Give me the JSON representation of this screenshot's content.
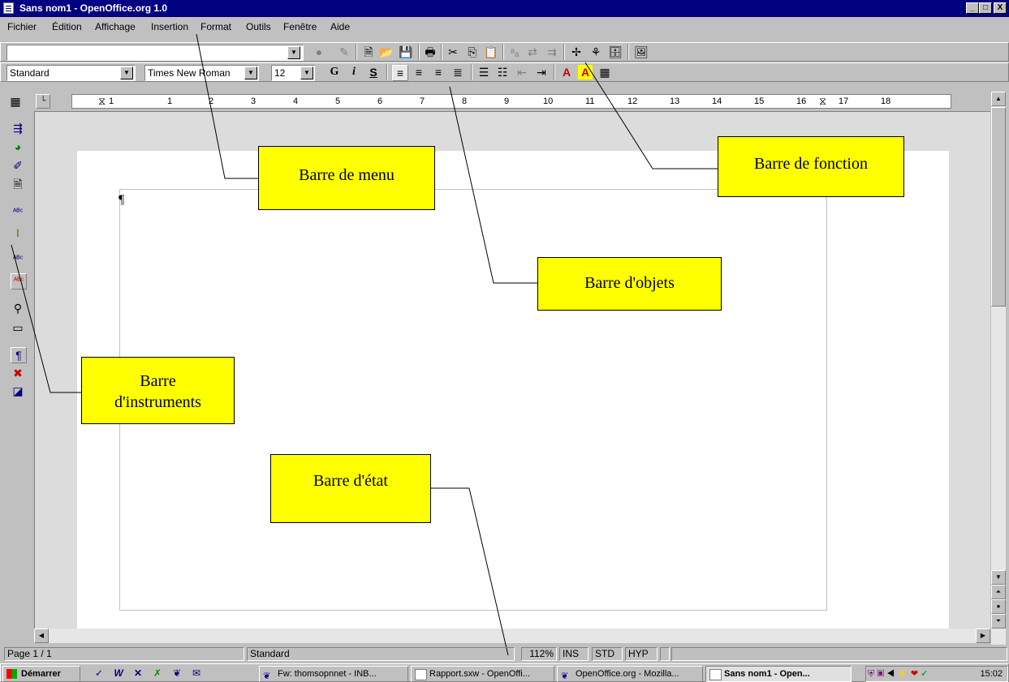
{
  "window": {
    "title": "Sans nom1 - OpenOffice.org 1.0",
    "buttons": [
      "_",
      "□",
      "X"
    ]
  },
  "menubar": {
    "items": [
      "Fichier",
      "Édition",
      "Affichage",
      "Insertion",
      "Format",
      "Outils",
      "Fenêtre",
      "Aide"
    ]
  },
  "function_bar": {
    "url_value": ""
  },
  "object_bar": {
    "style": "Standard",
    "font": "Times New Roman",
    "size": "12",
    "bold": "G",
    "italic": "i",
    "underline": "S"
  },
  "ruler": {
    "ticks": [
      "1",
      "1",
      "2",
      "3",
      "4",
      "5",
      "6",
      "7",
      "8",
      "9",
      "10",
      "11",
      "12",
      "13",
      "14",
      "15",
      "16",
      "17",
      "18"
    ]
  },
  "document": {
    "paragraph_mark": "¶"
  },
  "callouts": {
    "menu": "Barre de menu",
    "fonction": "Barre de fonction",
    "objets": "Barre d'objets",
    "instruments_1": "Barre",
    "instruments_2": "d'instruments",
    "etat": "Barre d'état"
  },
  "statusbar": {
    "page": "Page 1 / 1",
    "style": "Standard",
    "zoom": "112%",
    "ins": "INS",
    "std": "STD",
    "hyp": "HYP"
  },
  "taskbar": {
    "start": "Démarrer",
    "tasks": [
      "Fw: thomsopnnet - INB...",
      "Rapport.sxw - OpenOffi...",
      "OpenOffice.org - Mozilla...",
      "Sans nom1 - Open..."
    ],
    "clock": "15:02"
  },
  "colors": {
    "title": "#000080",
    "callout": "#ffff00",
    "face": "#c0c0c0"
  }
}
